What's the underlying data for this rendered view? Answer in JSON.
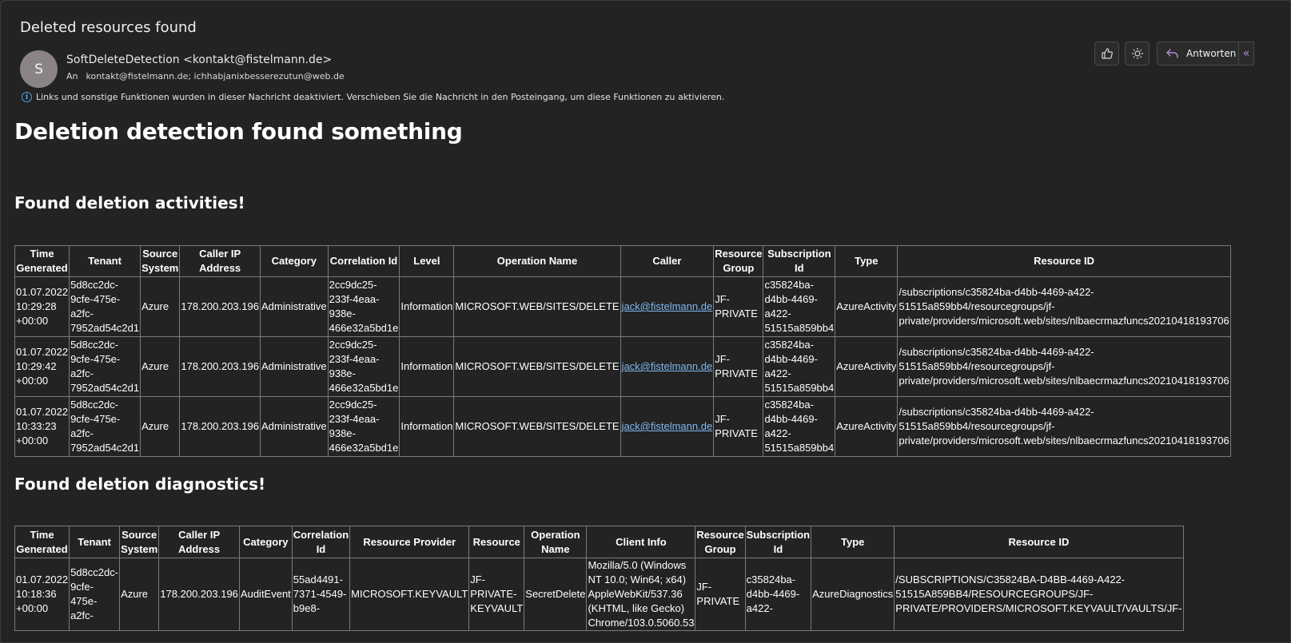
{
  "email": {
    "subject": "Deleted resources found",
    "avatar_letter": "S",
    "from": "SoftDeleteDetection <kontakt@fistelmann.de>",
    "to_label": "An",
    "to": "kontakt@fistelmann.de; ichhabjanixbesserezutun@web.de",
    "info_notice": "Links und sonstige Funktionen wurden in dieser Nachricht deaktiviert. Verschieben Sie die Nachricht in den Posteingang, um diese Funktionen zu aktivieren."
  },
  "toolbar": {
    "like_icon": "thumbs-up-icon",
    "theme_icon": "sun-icon",
    "reply_label": "Antworten",
    "reply_icon": "reply-icon",
    "more_icon": "reply-all-icon",
    "accent_color": "#b48cd6"
  },
  "body": {
    "title": "Deletion detection found something",
    "activities_heading": "Found deletion activities!",
    "diagnostics_heading": "Found deletion diagnostics!"
  },
  "activities_table": {
    "headers": [
      "Time\nGenerated",
      "Tenant",
      "Source\nSystem",
      "Caller IP\nAddress",
      "Category",
      "Correlation Id",
      "Level",
      "Operation Name",
      "Caller",
      "Resource\nGroup",
      "Subscription\nId",
      "Type",
      "Resource ID"
    ],
    "rows": [
      {
        "time": "01.07.2022\n10:29:28\n+00:00",
        "tenant": "5d8cc2dc-\n9cfe-475e-\na2fc-\n7952ad54c2d1",
        "source": "Azure",
        "ip": "178.200.203.196",
        "category": "Administrative",
        "correlation": "2cc9dc25-\n233f-4eaa-\n938e-\n466e32a5bd1e",
        "level": "Information",
        "operation": "MICROSOFT.WEB/SITES/DELETE",
        "caller": "jack@fistelmann.de",
        "group": "JF-\nPRIVATE",
        "subscription": "c35824ba-\nd4bb-4469-\na422-\n51515a859bb4",
        "type": "AzureActivity",
        "resource": "/subscriptions/c35824ba-d4bb-4469-a422-\n51515a859bb4/resourcegroups/jf-\nprivate/providers/microsoft.web/sites/nlbaecrmazfuncs20210418193706"
      },
      {
        "time": "01.07.2022\n10:29:42\n+00:00",
        "tenant": "5d8cc2dc-\n9cfe-475e-\na2fc-\n7952ad54c2d1",
        "source": "Azure",
        "ip": "178.200.203.196",
        "category": "Administrative",
        "correlation": "2cc9dc25-\n233f-4eaa-\n938e-\n466e32a5bd1e",
        "level": "Information",
        "operation": "MICROSOFT.WEB/SITES/DELETE",
        "caller": "jack@fistelmann.de",
        "group": "JF-\nPRIVATE",
        "subscription": "c35824ba-\nd4bb-4469-\na422-\n51515a859bb4",
        "type": "AzureActivity",
        "resource": "/subscriptions/c35824ba-d4bb-4469-a422-\n51515a859bb4/resourcegroups/jf-\nprivate/providers/microsoft.web/sites/nlbaecrmazfuncs20210418193706"
      },
      {
        "time": "01.07.2022\n10:33:23\n+00:00",
        "tenant": "5d8cc2dc-\n9cfe-475e-\na2fc-\n7952ad54c2d1",
        "source": "Azure",
        "ip": "178.200.203.196",
        "category": "Administrative",
        "correlation": "2cc9dc25-\n233f-4eaa-\n938e-\n466e32a5bd1e",
        "level": "Information",
        "operation": "MICROSOFT.WEB/SITES/DELETE",
        "caller": "jack@fistelmann.de",
        "group": "JF-\nPRIVATE",
        "subscription": "c35824ba-\nd4bb-4469-\na422-\n51515a859bb4",
        "type": "AzureActivity",
        "resource": "/subscriptions/c35824ba-d4bb-4469-a422-\n51515a859bb4/resourcegroups/jf-\nprivate/providers/microsoft.web/sites/nlbaecrmazfuncs20210418193706"
      }
    ]
  },
  "diagnostics_table": {
    "headers": [
      "Time\nGenerated",
      "Tenant",
      "Source\nSystem",
      "Caller IP\nAddress",
      "Category",
      "Correlation Id",
      "Resource Provider",
      "Resource",
      "Operation\nName",
      "Client Info",
      "Resource\nGroup",
      "Subscription\nId",
      "Type",
      "Resource ID"
    ],
    "rows": [
      {
        "time": "01.07.2022\n10:18:36\n+00:00",
        "tenant": "5d8cc2dc-\n9cfe-475e-\na2fc-",
        "source": "Azure",
        "ip": "178.200.203.196",
        "category": "AuditEvent",
        "correlation": "55ad4491-\n7371-4549-\nb9e8-",
        "provider": "MICROSOFT.KEYVAULT",
        "resource": "JF-\nPRIVATE-\nKEYVAULT",
        "operation": "SecretDelete",
        "client": "Mozilla/5.0 (Windows\nNT 10.0; Win64; x64)\nAppleWebKit/537.36\n(KHTML, like Gecko)\nChrome/103.0.5060.53",
        "group": "JF-\nPRIVATE",
        "subscription": "c35824ba-\nd4bb-4469-\na422-",
        "type": "AzureDiagnostics",
        "resource_id": "/SUBSCRIPTIONS/C35824BA-D4BB-4469-A422-\n51515A859BB4/RESOURCEGROUPS/JF-\nPRIVATE/PROVIDERS/MICROSOFT.KEYVAULT/VAULTS/JF-"
      }
    ]
  }
}
